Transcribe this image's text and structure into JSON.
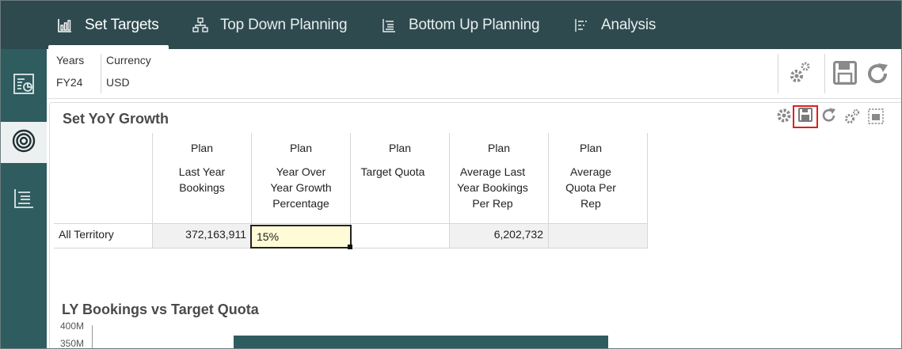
{
  "nav": {
    "tabs": [
      {
        "label": "Set Targets",
        "icon": "bar-chart-icon",
        "active": true
      },
      {
        "label": "Top Down Planning",
        "icon": "hierarchy-icon"
      },
      {
        "label": "Bottom Up Planning",
        "icon": "list-tree-icon"
      },
      {
        "label": "Analysis",
        "icon": "analysis-icon"
      }
    ]
  },
  "sidebar": {
    "items": [
      {
        "icon": "report-icon"
      },
      {
        "icon": "target-icon",
        "active": true
      },
      {
        "icon": "hierarchy-list-icon"
      }
    ]
  },
  "pov": {
    "years_label": "Years",
    "years_value": "FY24",
    "currency_label": "Currency",
    "currency_value": "USD"
  },
  "panel": {
    "title": "Set YoY Growth"
  },
  "grid": {
    "columns": [
      {
        "top": "Plan",
        "label": "Last Year\nBookings"
      },
      {
        "top": "Plan",
        "label": "Year Over\nYear Growth\nPercentage"
      },
      {
        "top": "Plan",
        "label": "Target Quota"
      },
      {
        "top": "Plan",
        "label": "Average Last\nYear Bookings\nPer Rep"
      },
      {
        "top": "Plan",
        "label": "Average\nQuota Per\nRep"
      }
    ],
    "row_header": "All Territory",
    "row_values": [
      "372,163,911",
      "15%",
      "",
      "6,202,732",
      ""
    ]
  },
  "chart": {
    "title": "LY Bookings vs Target Quota",
    "ticks": [
      "400M",
      "350M"
    ]
  },
  "colors": {
    "nav_bg": "#2f4a4f",
    "sidebar_bg": "#2f5c5e",
    "bar": "#2f5c5e",
    "edited_cell": "#fffbd6",
    "highlight_red": "#e01e1e"
  }
}
